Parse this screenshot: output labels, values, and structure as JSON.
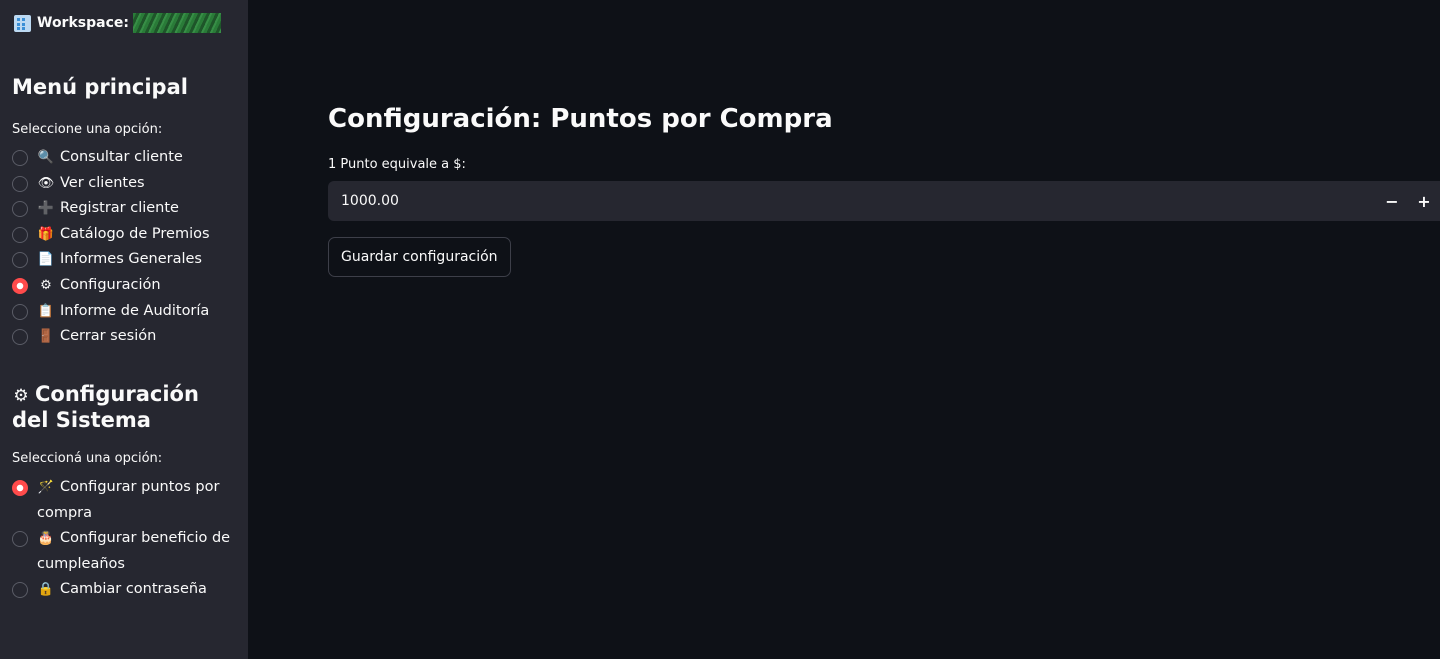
{
  "workspace": {
    "label": "Workspace:"
  },
  "menu": {
    "title": "Menú principal",
    "prompt": "Seleccione una opción:",
    "items": [
      {
        "icon": "magnifier-icon",
        "glyph": "🔍",
        "label": "Consultar cliente",
        "checked": false
      },
      {
        "icon": "eye-icon",
        "glyph": "👁",
        "label": "Ver clientes",
        "checked": false
      },
      {
        "icon": "plus-icon",
        "glyph": "➕",
        "label": "Registrar cliente",
        "checked": false
      },
      {
        "icon": "gift-icon",
        "glyph": "🎁",
        "label": "Catálogo de Premios",
        "checked": false
      },
      {
        "icon": "document-icon",
        "glyph": "📄",
        "label": "Informes Generales",
        "checked": false
      },
      {
        "icon": "gear-icon",
        "glyph": "⚙",
        "label": "Configuración",
        "checked": true
      },
      {
        "icon": "clipboard-icon",
        "glyph": "📋",
        "label": "Informe de Auditoría",
        "checked": false
      },
      {
        "icon": "door-icon",
        "glyph": "🚪",
        "label": "Cerrar sesión",
        "checked": false
      }
    ]
  },
  "system_config": {
    "icon": "gear-icon",
    "glyph": "⚙",
    "title": "Configuración del Sistema",
    "prompt": "Seleccioná una opción:",
    "items": [
      {
        "icon": "wand-icon",
        "glyph": "🪄",
        "label": "Configurar puntos por compra",
        "checked": true
      },
      {
        "icon": "cake-icon",
        "glyph": "🎂",
        "label": "Configurar beneficio de cumpleaños",
        "checked": false
      },
      {
        "icon": "lock-icon",
        "glyph": "🔒",
        "label": "Cambiar contraseña",
        "checked": false
      }
    ]
  },
  "main": {
    "title": "Configuración: Puntos por Compra",
    "input_label": "1 Punto equivale a $:",
    "input_value": "1000.00",
    "minus_label": "−",
    "plus_label": "+",
    "save_label": "Guardar configuración"
  },
  "colors": {
    "sidebar_bg": "#262730",
    "main_bg": "#0e1117",
    "accent": "#ff4b4b"
  }
}
